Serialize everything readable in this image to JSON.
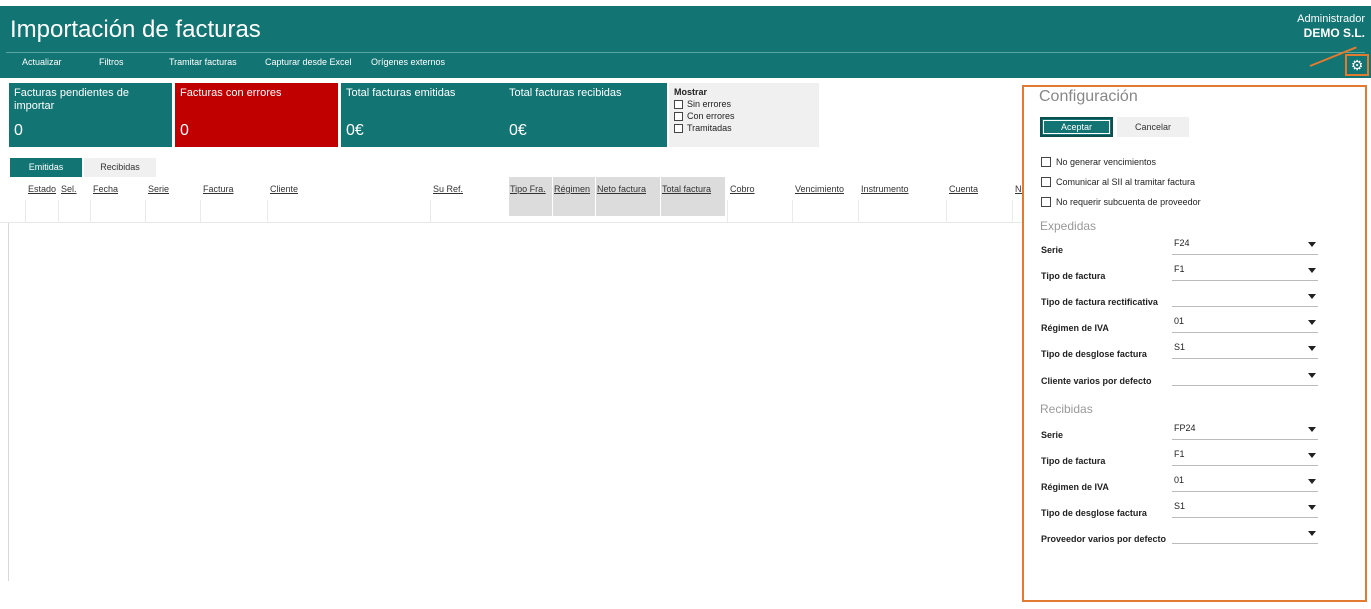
{
  "header": {
    "title": "Importación de facturas",
    "role": "Administrador",
    "company": "DEMO S.L.",
    "brand_color": "#127473"
  },
  "toolbar": {
    "items": [
      "Actualizar",
      "Filtros",
      "Tramitar facturas",
      "Capturar desde Excel",
      "Orígenes externos"
    ],
    "settings_icon": "gear-icon"
  },
  "tiles": [
    {
      "label": "Facturas pendientes de importar",
      "value": "0"
    },
    {
      "label": "Facturas con errores",
      "value": "0",
      "color": "#c00000"
    },
    {
      "label": "Total facturas emitidas",
      "value": "0€"
    },
    {
      "label": "Total facturas recibidas",
      "value": "0€"
    }
  ],
  "mostrar": {
    "title": "Mostrar",
    "options": [
      "Sin errores",
      "Con errores",
      "Tramitadas"
    ]
  },
  "tabs": {
    "emitidas": "Emitidas",
    "recibidas": "Recibidas"
  },
  "columns": [
    "Estado",
    "Sel.",
    "Fecha",
    "Serie",
    "Factura",
    "Cliente",
    "Su Ref.",
    "Tipo Fra.",
    "Régimen",
    "Neto factura",
    "Total factura",
    "Cobro",
    "Vencimiento",
    "Instrumento",
    "Cuenta",
    "N:"
  ],
  "config": {
    "title": "Configuración",
    "accept": "Aceptar",
    "cancel": "Cancelar",
    "options": [
      "No generar vencimientos",
      "Comunicar al SII al tramitar factura",
      "No requerir subcuenta de proveedor"
    ],
    "highlight_color": "#e27a2f",
    "expedidas": {
      "title": "Expedidas",
      "fields": [
        {
          "label": "Serie",
          "value": "F24"
        },
        {
          "label": "Tipo de factura",
          "value": "F1"
        },
        {
          "label": "Tipo de factura rectificativa",
          "value": ""
        },
        {
          "label": "Régimen de IVA",
          "value": "01"
        },
        {
          "label": "Tipo de desglose factura",
          "value": "S1"
        },
        {
          "label": "Cliente varios por defecto",
          "value": ""
        }
      ]
    },
    "recibidas": {
      "title": "Recibidas",
      "fields": [
        {
          "label": "Serie",
          "value": "FP24"
        },
        {
          "label": "Tipo de factura",
          "value": "F1"
        },
        {
          "label": "Régimen de IVA",
          "value": "01"
        },
        {
          "label": "Tipo de desglose factura",
          "value": "S1"
        },
        {
          "label": "Proveedor varios por defecto",
          "value": ""
        }
      ]
    }
  }
}
